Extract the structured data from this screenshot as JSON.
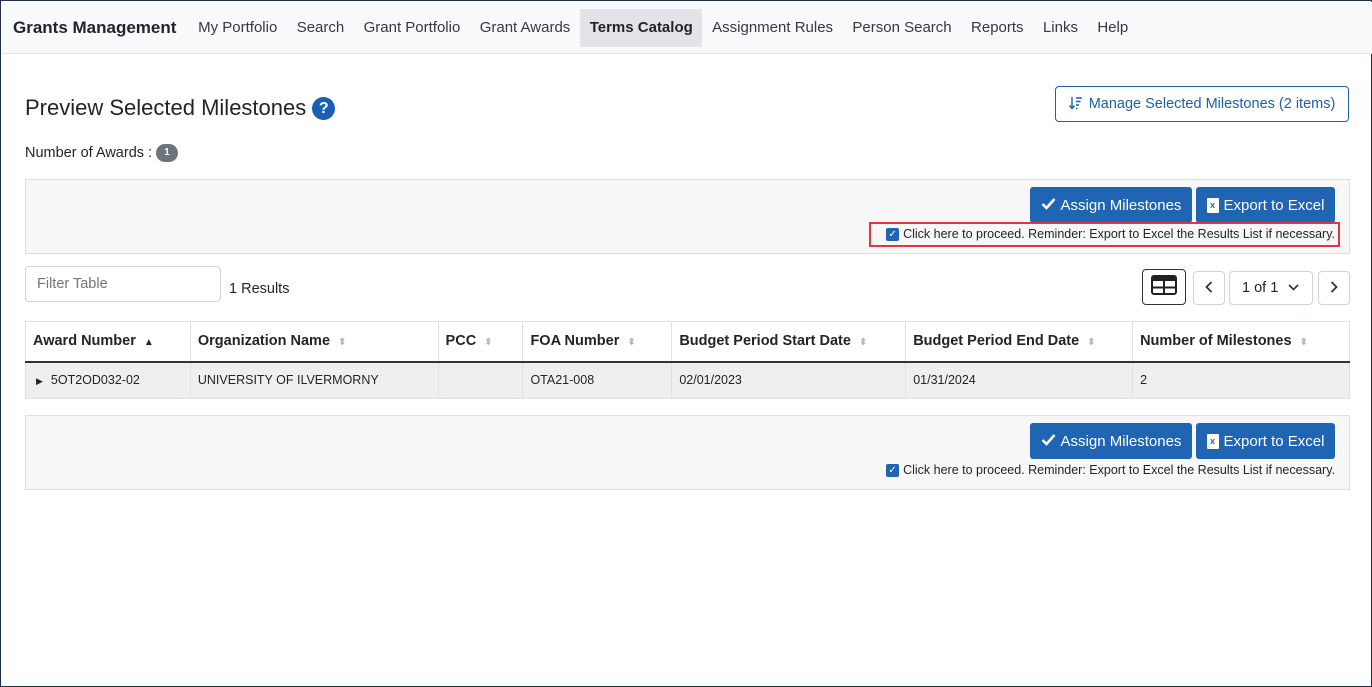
{
  "nav": {
    "brand": "Grants Management",
    "items": [
      {
        "label": "My Portfolio"
      },
      {
        "label": "Search"
      },
      {
        "label": "Grant Portfolio"
      },
      {
        "label": "Grant Awards"
      },
      {
        "label": "Terms Catalog",
        "active": true
      },
      {
        "label": "Assignment Rules"
      },
      {
        "label": "Person Search"
      },
      {
        "label": "Reports"
      },
      {
        "label": "Links"
      },
      {
        "label": "Help"
      }
    ]
  },
  "header": {
    "title": "Preview Selected Milestones",
    "help_glyph": "?",
    "manage_button": "Manage Selected Milestones (2 items)",
    "awards_label": "Number of Awards :",
    "awards_count": "1"
  },
  "actions": {
    "assign_label": "Assign Milestones",
    "export_label": "Export to Excel",
    "proceed_text": "Click here to proceed. Reminder: Export to Excel the Results List if necessary.",
    "proceed_checked": true
  },
  "filter": {
    "placeholder": "Filter Table",
    "results": "1 Results"
  },
  "pager": {
    "current": "1 of 1"
  },
  "table": {
    "headers": [
      "Award Number",
      "Organization Name",
      "PCC",
      "FOA Number",
      "Budget Period Start Date",
      "Budget Period End Date",
      "Number of Milestones"
    ],
    "rows": [
      {
        "award_number": "5OT2OD032-02",
        "organization": "UNIVERSITY OF ILVERMORNY",
        "pcc": "",
        "foa": "OTA21-008",
        "start": "02/01/2023",
        "end": "01/31/2024",
        "milestones": "2"
      }
    ]
  },
  "colors": {
    "primary": "#1f65b4",
    "highlight": "#e0363c",
    "badge": "#6c757d"
  },
  "icons": {
    "help": "question-circle-icon",
    "sort": "sort-amount-down-icon",
    "check": "check-icon",
    "excel": "file-excel-icon",
    "grid": "table-grid-icon"
  }
}
